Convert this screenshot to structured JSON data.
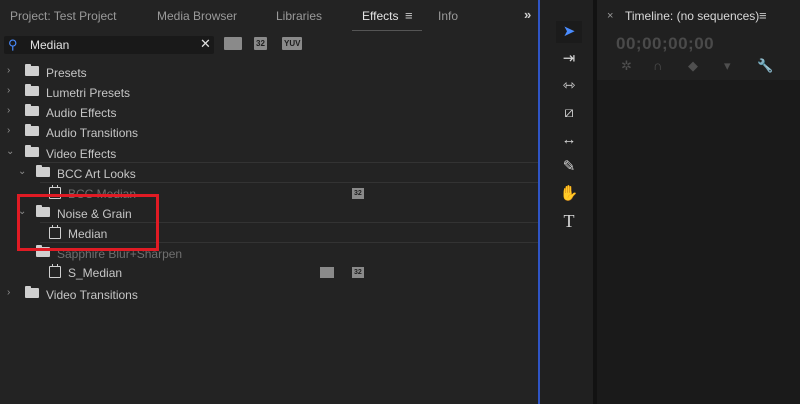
{
  "tabs": [
    {
      "label": "Project: Test Project"
    },
    {
      "label": "Media Browser"
    },
    {
      "label": "Libraries"
    },
    {
      "label": "Effects"
    },
    {
      "label": "Info"
    }
  ],
  "icons": {
    "tab_menu": "≡",
    "overflow": "»",
    "search": "⚲",
    "clear": "✕"
  },
  "search": {
    "value": "Median",
    "placeholder": ""
  },
  "filters": [
    "32",
    "YUV"
  ],
  "tree": [
    {
      "label": "Presets"
    },
    {
      "label": "Lumetri Presets"
    },
    {
      "label": "Audio Effects"
    },
    {
      "label": "Audio Transitions"
    },
    {
      "label": "Video Effects"
    },
    {
      "label": "BCC Art Looks"
    },
    {
      "label": "BCC Median"
    },
    {
      "label": "Noise & Grain"
    },
    {
      "label": "Median"
    },
    {
      "label": "Sapphire Blur+Sharpen"
    },
    {
      "label": "S_Median"
    },
    {
      "label": "Video Transitions"
    }
  ],
  "item_badges": {
    "bcc_median": "32",
    "s_median": "32"
  },
  "timeline": {
    "close": "×",
    "title": "Timeline: (no sequences)",
    "menu": "≡",
    "timecode": "00;00;00;00"
  },
  "accent_color": "#2f55c5",
  "highlight_color": "#e01b24"
}
